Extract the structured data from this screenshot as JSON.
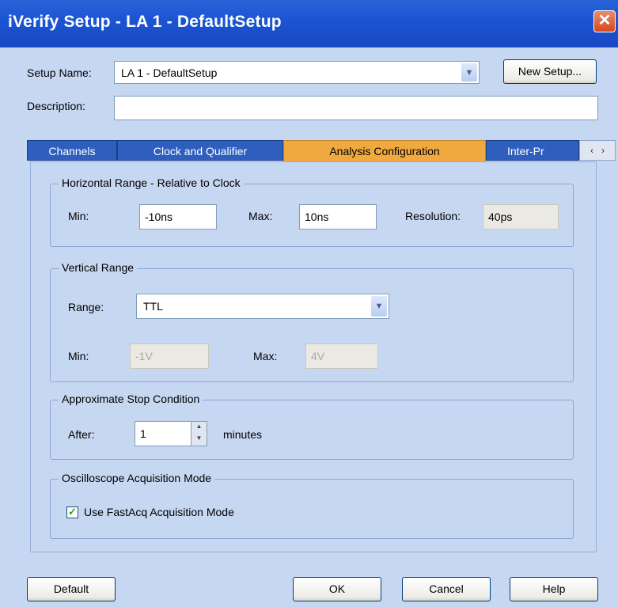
{
  "window": {
    "title": "iVerify Setup - LA 1 - DefaultSetup",
    "close_glyph": "✕"
  },
  "setup": {
    "name_label": "Setup Name:",
    "name_value": "LA 1 - DefaultSetup",
    "new_setup_label": "New Setup...",
    "description_label": "Description:",
    "description_value": ""
  },
  "tabs": [
    {
      "label": "Channels",
      "active": false
    },
    {
      "label": "Clock and Qualifier",
      "active": false
    },
    {
      "label": "Analysis Configuration",
      "active": true
    },
    {
      "label": "Inter-Pr",
      "active": false
    }
  ],
  "tab_scroll": {
    "left": "‹",
    "right": "›"
  },
  "horizontal_range": {
    "title": "Horizontal Range - Relative to Clock",
    "min_label": "Min:",
    "min_value": "-10ns",
    "max_label": "Max:",
    "max_value": "10ns",
    "resolution_label": "Resolution:",
    "resolution_value": "40ps"
  },
  "vertical_range": {
    "title": "Vertical Range",
    "range_label": "Range:",
    "range_value": "TTL",
    "min_label": "Min:",
    "min_value": "-1V",
    "max_label": "Max:",
    "max_value": "4V"
  },
  "stop_condition": {
    "title": "Approximate Stop Condition",
    "after_label": "After:",
    "after_value": "1",
    "unit_label": "minutes"
  },
  "acquisition": {
    "title": "Oscilloscope Acquisition Mode",
    "fastacq_label": "Use FastAcq Acquisition Mode",
    "fastacq_checked": true
  },
  "buttons": {
    "default": "Default",
    "ok": "OK",
    "cancel": "Cancel",
    "help": "Help"
  },
  "colors": {
    "titlebar": "#1b55d3",
    "client": "#c6d7f1",
    "active_tab": "#f0a93f",
    "tab": "#2f5fbe"
  }
}
